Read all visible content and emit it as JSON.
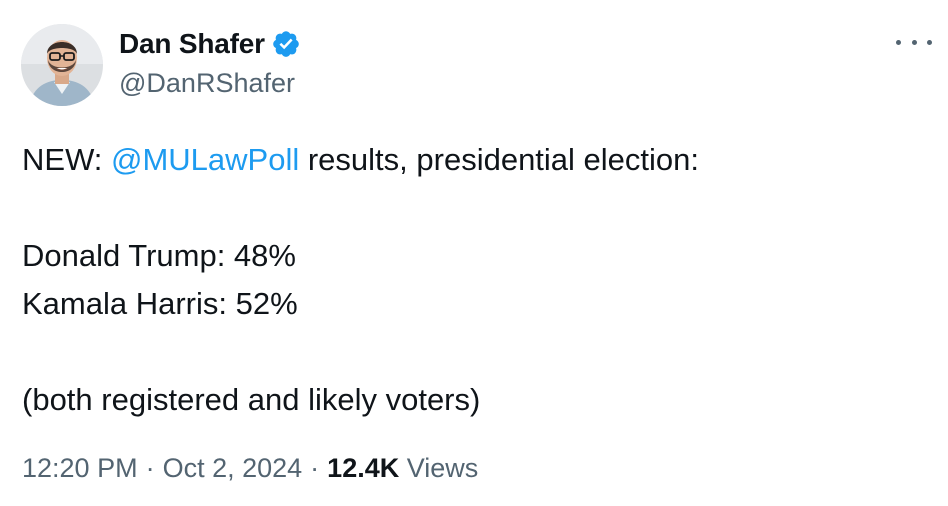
{
  "author": {
    "display_name": "Dan Shafer",
    "handle": "@DanRShafer",
    "verified": true
  },
  "tweet": {
    "lines": [
      {
        "prefix": "NEW: ",
        "mention": "@MULawPoll",
        "suffix": " results, presidential election:"
      },
      {
        "text": ""
      },
      {
        "text": "Donald Trump: 48%"
      },
      {
        "text": "Kamala Harris: 52%"
      },
      {
        "text": ""
      },
      {
        "text": "(both registered and likely voters)"
      }
    ]
  },
  "meta": {
    "time": "12:20 PM",
    "separator": "·",
    "date": "Oct 2, 2024",
    "views_count": "12.4K",
    "views_label": "Views"
  },
  "icons": {
    "verified": "verified-badge-icon",
    "more": "more-options-icon"
  },
  "colors": {
    "accent": "#1d9bf0",
    "text": "#0f1419",
    "secondary": "#536471"
  }
}
